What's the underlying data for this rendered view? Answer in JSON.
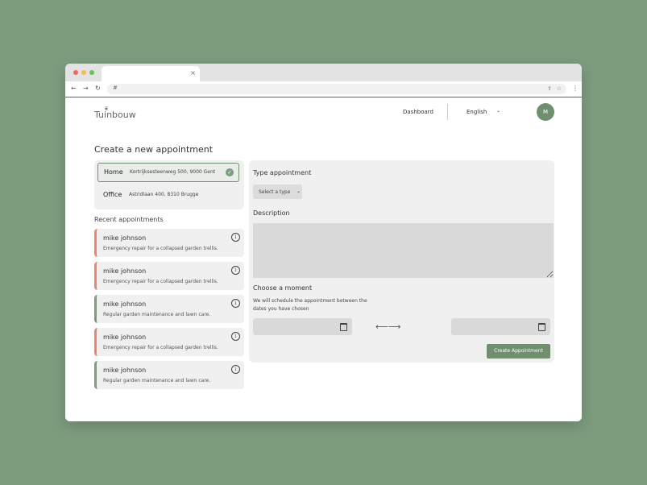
{
  "browser": {
    "tab_close": "×",
    "url": "#"
  },
  "header": {
    "logo": "Tuinbouw",
    "nav_dashboard": "Dashboard",
    "language": "English",
    "avatar_initial": "M"
  },
  "page_title": "Create a new appointment",
  "addresses": [
    {
      "label": "Home",
      "street": "Kortrijksesteenweg 500, 9000 Gent",
      "selected": true
    },
    {
      "label": "Office",
      "street": "Astridlaan 400, 8310 Brugge",
      "selected": false
    }
  ],
  "recent": {
    "title": "Recent appointments",
    "items": [
      {
        "name": "mike johnson",
        "desc": "Emergency repair for a collapsed garden trellis.",
        "status": "urgent"
      },
      {
        "name": "mike johnson",
        "desc": "Emergency repair for a collapsed garden trellis.",
        "status": "urgent"
      },
      {
        "name": "mike johnson",
        "desc": "Regular garden maintenance and lawn care.",
        "status": "regular"
      },
      {
        "name": "mike johnson",
        "desc": "Emergency repair for a collapsed garden trellis.",
        "status": "urgent"
      },
      {
        "name": "mike johnson",
        "desc": "Regular garden maintenance and lawn care.",
        "status": "regular"
      }
    ]
  },
  "form": {
    "type_label": "Type appointment",
    "type_select": "Select a type",
    "description_label": "Description",
    "moment_label": "Choose a moment",
    "moment_hint": "We will schedule the appointment between the dates you have chosen",
    "range_arrow": "⟵⟶",
    "submit": "Create Appointment"
  },
  "colors": {
    "background": "#7d9c7e",
    "accent": "#6f8f6f",
    "urgent": "#e8876f",
    "regular": "#7d9c7e"
  }
}
